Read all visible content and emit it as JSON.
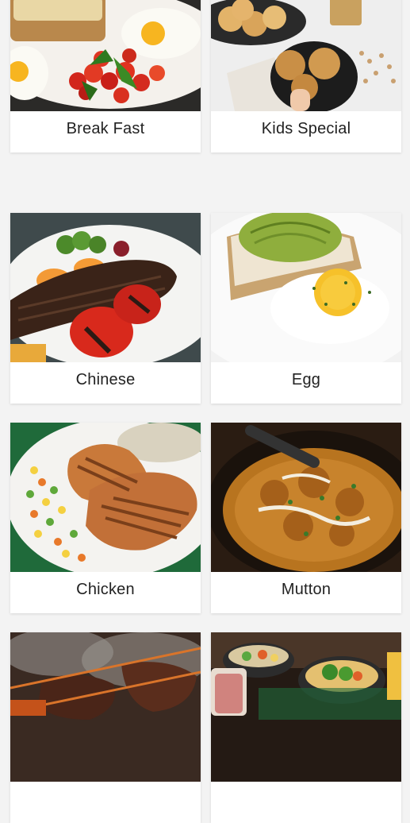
{
  "categories": [
    {
      "label": "Break Fast",
      "image_icon": "breakfast-plate-image"
    },
    {
      "label": "Kids Special",
      "image_icon": "pinwheel-pastries-image"
    },
    {
      "label": "Chinese",
      "image_icon": "grilled-meat-plate-image"
    },
    {
      "label": "Egg",
      "image_icon": "avocado-toast-egg-image"
    },
    {
      "label": "Chicken",
      "image_icon": "grilled-chicken-image"
    },
    {
      "label": "Mutton",
      "image_icon": "mutton-curry-image"
    },
    {
      "label": "",
      "image_icon": "barbecue-grill-image"
    },
    {
      "label": "",
      "image_icon": "salad-bowls-image"
    }
  ],
  "colors": {
    "background": "#f3f3f3",
    "card": "#ffffff",
    "label_text": "#222222"
  }
}
